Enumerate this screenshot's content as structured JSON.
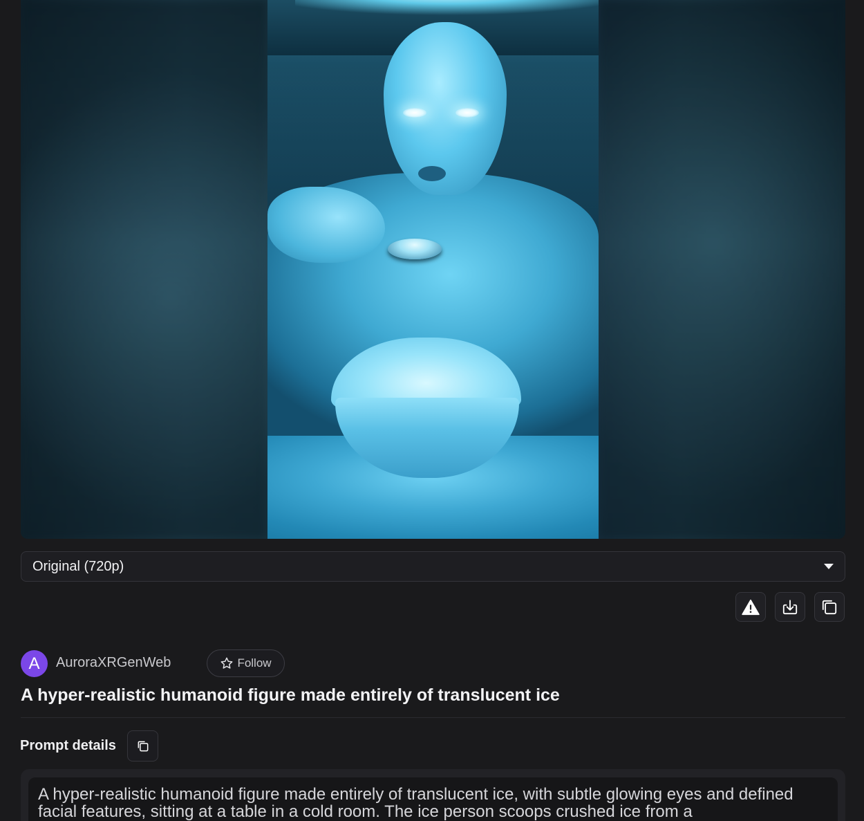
{
  "video": {
    "alt": "Ice humanoid figure eating crushed ice from a bowl"
  },
  "quality": {
    "selected": "Original (720p)"
  },
  "actions": {
    "report_icon": "warning-icon",
    "download_icon": "download-icon",
    "copy_icon": "copy-icon"
  },
  "author": {
    "avatar_letter": "A",
    "avatar_color": "#7b47e8",
    "name": "AuroraXRGenWeb",
    "follow_label": "Follow"
  },
  "title": "A hyper-realistic humanoid figure made entirely of translucent ice",
  "prompt": {
    "label": "Prompt details",
    "text": "A hyper-realistic humanoid figure made entirely of translucent ice, with subtle glowing eyes and defined facial features, sitting at a table in a cold room. The ice person scoops crushed ice from a"
  }
}
